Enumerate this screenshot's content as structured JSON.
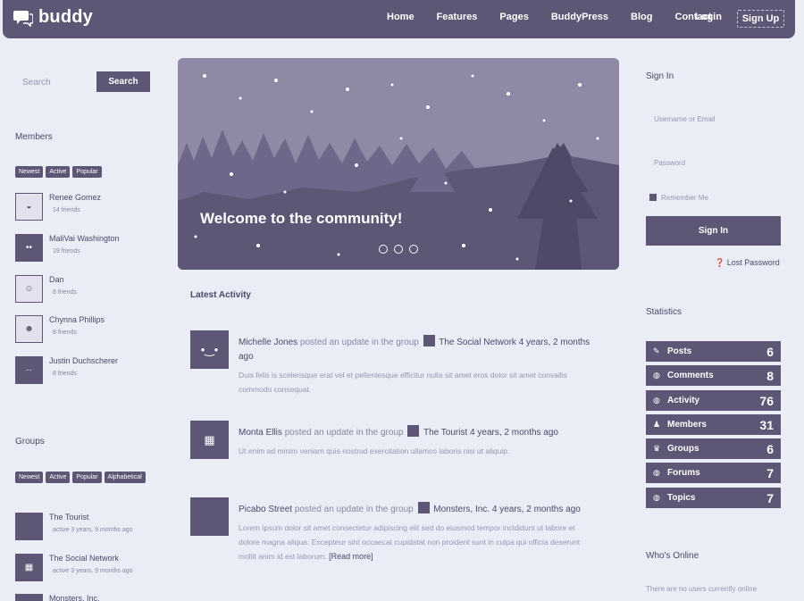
{
  "header": {
    "logo_text": "buddy",
    "nav": [
      "Home",
      "Features",
      "Pages",
      "BuddyPress",
      "Blog",
      "Contact"
    ],
    "login": "Login",
    "signup": "Sign Up"
  },
  "search": {
    "placeholder": "Search",
    "button": "Search"
  },
  "members_widget": {
    "title": "Members",
    "filters": [
      "Newest",
      "Active",
      "Popular"
    ],
    "items": [
      {
        "name": "Renee Gomez",
        "meta": "14 friends"
      },
      {
        "name": "MaliVai Washington",
        "meta": "19 friends"
      },
      {
        "name": "Dan",
        "meta": "8 friends"
      },
      {
        "name": "Chynna Phillips",
        "meta": "8 friends"
      },
      {
        "name": "Justin Duchscherer",
        "meta": "8 friends"
      }
    ]
  },
  "groups_widget": {
    "title": "Groups",
    "filters": [
      "Newest",
      "Active",
      "Popular",
      "Alphabetical"
    ],
    "items": [
      {
        "name": "The Tourist",
        "meta": "active 3 years, 9 months ago"
      },
      {
        "name": "The Social Network",
        "meta": "active 3 years, 9 months ago"
      },
      {
        "name": "Monsters, Inc.",
        "meta": ""
      }
    ]
  },
  "hero": {
    "title": "Welcome to the community!"
  },
  "activity": {
    "title": "Latest Activity",
    "items": [
      {
        "user": "Michelle Jones",
        "verb": "posted an update in the group",
        "group": "The Social Network",
        "time": "4 years, 2 months ago",
        "excerpt": "Duis felis is scelerisque erat vel et pellentesque efficitur nulla sit amet eros dolor sit amet convallis commodo consequat."
      },
      {
        "user": "Monta Ellis",
        "verb": "posted an update in the group",
        "group": "The Tourist",
        "time": "4 years, 2 months ago",
        "excerpt": "Ut enim ad minim veniam quis nostrud exercitation ullamco laboris nisi ut aliquip."
      },
      {
        "user": "Picabo Street",
        "verb": "posted an update in the group",
        "group": "Monsters, Inc.",
        "time": "4 years, 2 months ago",
        "excerpt": "Lorem ipsum dolor sit amet consectetur adipiscing elit sed do eiusmod tempor incididunt ut labore et dolore magna aliqua. Excepteur sint occaecat cupidatat non proident sunt in culpa qui officia deserunt mollit anim id est laborum.",
        "read_more": "[Read more]"
      }
    ]
  },
  "signin_widget": {
    "title": "Sign In",
    "username_placeholder": "Username or Email",
    "password_placeholder": "Password",
    "remember": "Remember Me",
    "button": "Sign In",
    "lost_password": "Lost Password"
  },
  "statistics": {
    "title": "Statistics",
    "items": [
      {
        "icon": "pencil-icon",
        "glyph": "✎",
        "label": "Posts",
        "count": "6"
      },
      {
        "icon": "comments-icon",
        "glyph": "◍",
        "label": "Comments",
        "count": "8"
      },
      {
        "icon": "activity-icon",
        "glyph": "◍",
        "label": "Activity",
        "count": "76"
      },
      {
        "icon": "user-icon",
        "glyph": "♟",
        "label": "Members",
        "count": "31"
      },
      {
        "icon": "group-icon",
        "glyph": "♛",
        "label": "Groups",
        "count": "6"
      },
      {
        "icon": "forum-icon",
        "glyph": "◍",
        "label": "Forums",
        "count": "7"
      },
      {
        "icon": "topic-icon",
        "glyph": "◍",
        "label": "Topics",
        "count": "7"
      }
    ]
  },
  "whos_online": {
    "title": "Who's Online",
    "text": "There are no users currently online"
  }
}
